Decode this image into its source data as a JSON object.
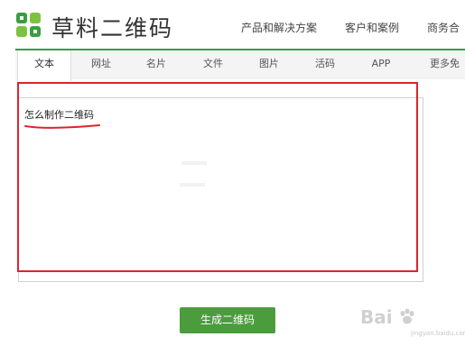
{
  "brand": {
    "name": "草料二维码",
    "logo_icon": "four-leaf-logo",
    "brand_color": "#3a9d3e"
  },
  "topnav": {
    "items": [
      "产品和解决方案",
      "客户和案例",
      "商务合"
    ]
  },
  "tabs": {
    "items": [
      "文本",
      "网址",
      "名片",
      "文件",
      "图片",
      "活码",
      "APP",
      "更多免"
    ],
    "active": "文本"
  },
  "editor": {
    "value": "怎么制作二维码"
  },
  "actions": {
    "generate_label": "生成二维码",
    "button_color": "#4b9c3d"
  },
  "annotation": {
    "color": "#d9262c"
  },
  "watermark": {
    "text": "Bai",
    "sub": "jingyan.baidu.com"
  }
}
